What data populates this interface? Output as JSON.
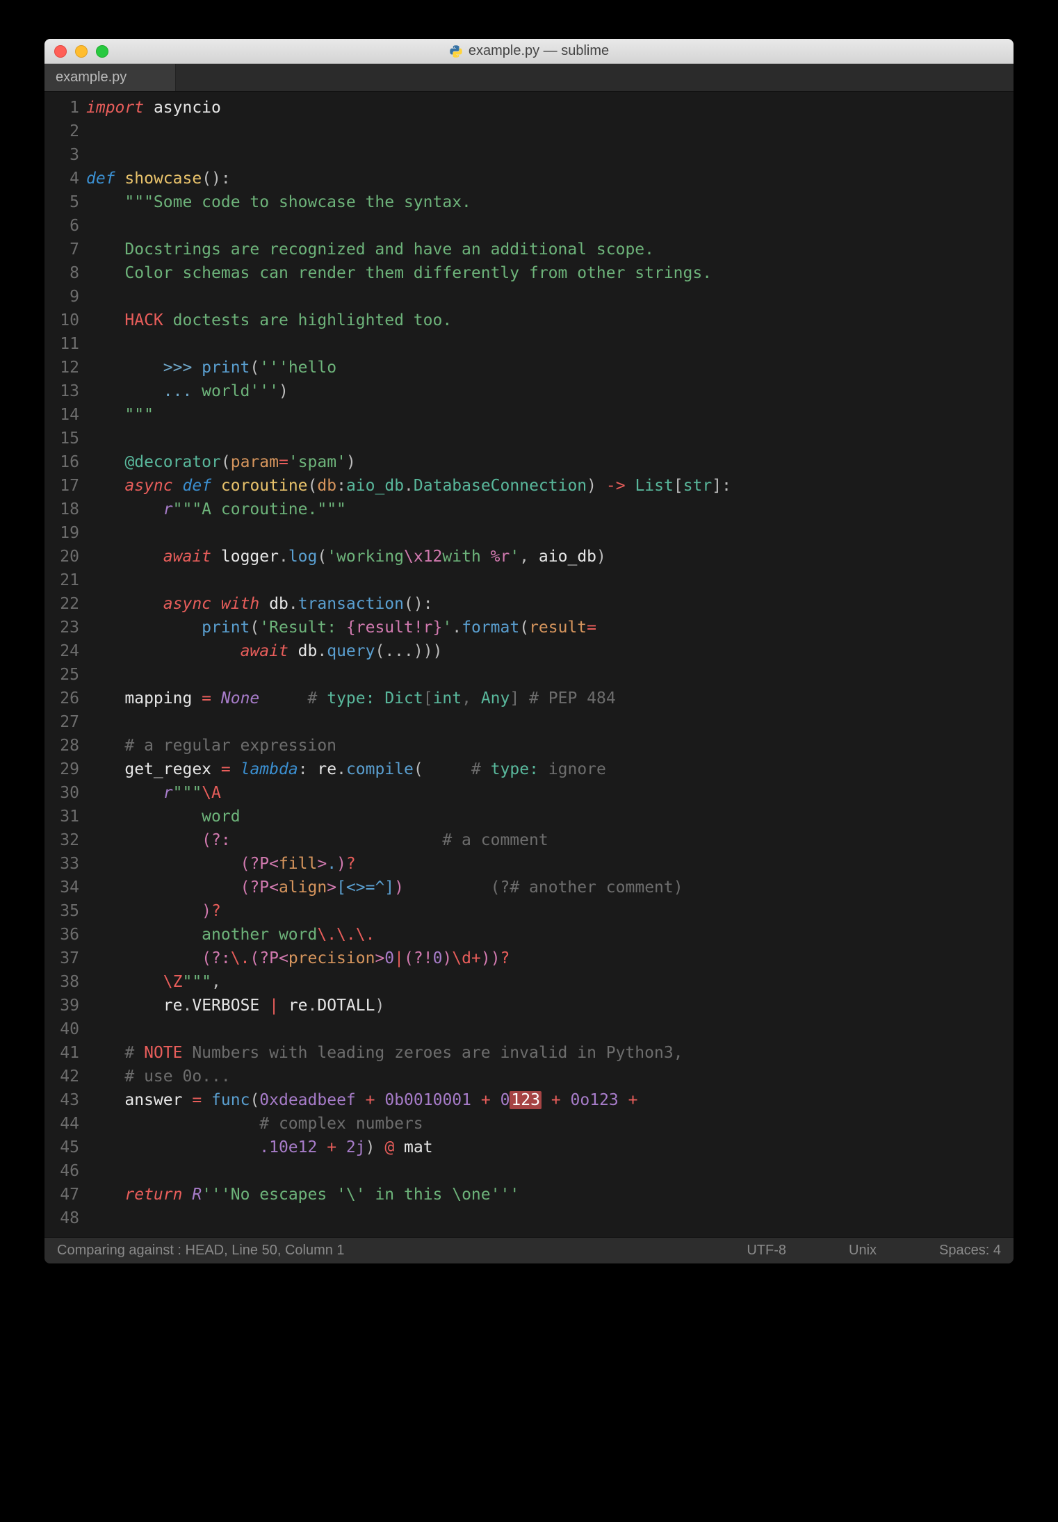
{
  "window": {
    "title": "example.py — sublime",
    "tab": "example.py"
  },
  "statusbar": {
    "left": "Comparing against : HEAD, Line 50, Column 1",
    "encoding": "UTF-8",
    "line_ending": "Unix",
    "indent": "Spaces: 4"
  },
  "gutter": {
    "start": 1,
    "end": 48
  },
  "code_lines": [
    [
      [
        "kw-red",
        "import"
      ],
      [
        "white",
        " asyncio"
      ]
    ],
    [],
    [],
    [
      [
        "kw-blue",
        "def"
      ],
      [
        "white",
        " "
      ],
      [
        "def-yellow",
        "showcase"
      ],
      [
        "paren",
        "():"
      ]
    ],
    [
      [
        "white",
        "    "
      ],
      [
        "str-green",
        "\"\"\"Some code to showcase the syntax."
      ]
    ],
    [],
    [
      [
        "white",
        "    "
      ],
      [
        "str-green",
        "Docstrings are recognized and have an additional scope."
      ]
    ],
    [
      [
        "white",
        "    "
      ],
      [
        "str-green",
        "Color schemas can render them differently from other strings."
      ]
    ],
    [],
    [
      [
        "white",
        "    "
      ],
      [
        "tag-red",
        "HACK"
      ],
      [
        "str-green",
        " doctests are highlighted too."
      ]
    ],
    [],
    [
      [
        "white",
        "        "
      ],
      [
        "doctest",
        ">>> "
      ],
      [
        "call-blue",
        "print"
      ],
      [
        "paren",
        "("
      ],
      [
        "str-green",
        "'''hello"
      ]
    ],
    [
      [
        "white",
        "        "
      ],
      [
        "doctest",
        "... "
      ],
      [
        "str-green",
        "world'''"
      ],
      [
        "paren",
        ")"
      ]
    ],
    [
      [
        "white",
        "    "
      ],
      [
        "str-green",
        "\"\"\""
      ]
    ],
    [],
    [
      [
        "white",
        "    "
      ],
      [
        "deco",
        "@decorator"
      ],
      [
        "paren",
        "("
      ],
      [
        "param-orange",
        "param"
      ],
      [
        "op-red",
        "="
      ],
      [
        "str-green",
        "'spam'"
      ],
      [
        "paren",
        ")"
      ]
    ],
    [
      [
        "white",
        "    "
      ],
      [
        "kw-red",
        "async"
      ],
      [
        "white",
        " "
      ],
      [
        "kw-blue",
        "def"
      ],
      [
        "white",
        " "
      ],
      [
        "def-yellow",
        "coroutine"
      ],
      [
        "paren",
        "("
      ],
      [
        "param-orange",
        "db"
      ],
      [
        "punct",
        ":"
      ],
      [
        "type-cyan",
        "aio_db"
      ],
      [
        "punct",
        "."
      ],
      [
        "type-cyan",
        "DatabaseConnection"
      ],
      [
        "paren",
        ")"
      ],
      [
        "white",
        " "
      ],
      [
        "arrow",
        "->"
      ],
      [
        "white",
        " "
      ],
      [
        "type-cyan",
        "List"
      ],
      [
        "punct",
        "["
      ],
      [
        "type-cyan",
        "str"
      ],
      [
        "punct",
        "]"
      ],
      [
        "punct",
        ":"
      ]
    ],
    [
      [
        "white",
        "        "
      ],
      [
        "r-prefix",
        "r"
      ],
      [
        "str-green",
        "\"\"\"A coroutine.\"\"\""
      ]
    ],
    [],
    [
      [
        "white",
        "        "
      ],
      [
        "kw-red",
        "await"
      ],
      [
        "white",
        " logger"
      ],
      [
        "punct",
        "."
      ],
      [
        "call-blue",
        "log"
      ],
      [
        "paren",
        "("
      ],
      [
        "str-green",
        "'working"
      ],
      [
        "esc-pink",
        "\\x12"
      ],
      [
        "str-green",
        "with "
      ],
      [
        "esc-pink",
        "%r"
      ],
      [
        "str-green",
        "'"
      ],
      [
        "punct",
        ","
      ],
      [
        "white",
        " aio_db"
      ],
      [
        "paren",
        ")"
      ]
    ],
    [],
    [
      [
        "white",
        "        "
      ],
      [
        "kw-red",
        "async"
      ],
      [
        "white",
        " "
      ],
      [
        "kw-red",
        "with"
      ],
      [
        "white",
        " db"
      ],
      [
        "punct",
        "."
      ],
      [
        "call-blue",
        "transaction"
      ],
      [
        "paren",
        "():"
      ]
    ],
    [
      [
        "white",
        "            "
      ],
      [
        "call-blue",
        "print"
      ],
      [
        "paren",
        "("
      ],
      [
        "str-green",
        "'Result: "
      ],
      [
        "esc-pink",
        "{result!r}"
      ],
      [
        "str-green",
        "'"
      ],
      [
        "punct",
        "."
      ],
      [
        "call-blue",
        "format"
      ],
      [
        "paren",
        "("
      ],
      [
        "param-orange",
        "result"
      ],
      [
        "op-red",
        "="
      ]
    ],
    [
      [
        "white",
        "                "
      ],
      [
        "kw-red",
        "await"
      ],
      [
        "white",
        " db"
      ],
      [
        "punct",
        "."
      ],
      [
        "call-blue",
        "query"
      ],
      [
        "paren",
        "("
      ],
      [
        "punct",
        "..."
      ],
      [
        "paren",
        ")))"
      ]
    ],
    [],
    [
      [
        "white",
        "    mapping "
      ],
      [
        "op-red",
        "="
      ],
      [
        "white",
        " "
      ],
      [
        "const-purple",
        "None"
      ],
      [
        "white",
        "     "
      ],
      [
        "comment",
        "# "
      ],
      [
        "type-cyan",
        "type: Dict"
      ],
      [
        "comment",
        "["
      ],
      [
        "type-cyan",
        "int"
      ],
      [
        "comment",
        ", "
      ],
      [
        "type-cyan",
        "Any"
      ],
      [
        "comment",
        "] "
      ],
      [
        "comment",
        "# PEP 484"
      ]
    ],
    [],
    [
      [
        "white",
        "    "
      ],
      [
        "comment",
        "# a regular expression"
      ]
    ],
    [
      [
        "white",
        "    get_regex "
      ],
      [
        "op-red",
        "="
      ],
      [
        "white",
        " "
      ],
      [
        "kw-blue",
        "lambda"
      ],
      [
        "punct",
        ":"
      ],
      [
        "white",
        " re"
      ],
      [
        "punct",
        "."
      ],
      [
        "call-blue",
        "compile"
      ],
      [
        "paren",
        "("
      ],
      [
        "white",
        "     "
      ],
      [
        "comment",
        "# "
      ],
      [
        "type-cyan",
        "type: "
      ],
      [
        "comment",
        "ignore"
      ]
    ],
    [
      [
        "white",
        "        "
      ],
      [
        "r-prefix",
        "r"
      ],
      [
        "str-green",
        "\"\"\""
      ],
      [
        "regex-kw",
        "\\A"
      ]
    ],
    [
      [
        "white",
        "            "
      ],
      [
        "str-green",
        "word"
      ]
    ],
    [
      [
        "white",
        "            "
      ],
      [
        "regex-grp",
        "(?:"
      ],
      [
        "white",
        "                      "
      ],
      [
        "comment",
        "# a comment"
      ]
    ],
    [
      [
        "white",
        "                "
      ],
      [
        "regex-grp",
        "(?P<"
      ],
      [
        "param-orange",
        "fill"
      ],
      [
        "regex-grp",
        ">"
      ],
      [
        "regex-cls",
        "."
      ],
      [
        "regex-grp",
        ")"
      ],
      [
        "regex-q",
        "?"
      ]
    ],
    [
      [
        "white",
        "                "
      ],
      [
        "regex-grp",
        "(?P<"
      ],
      [
        "param-orange",
        "align"
      ],
      [
        "regex-grp",
        ">"
      ],
      [
        "regex-cls",
        "[<>=^]"
      ],
      [
        "regex-grp",
        ")"
      ],
      [
        "white",
        "         "
      ],
      [
        "comment",
        "(?# another comment)"
      ]
    ],
    [
      [
        "white",
        "            "
      ],
      [
        "regex-grp",
        ")"
      ],
      [
        "regex-q",
        "?"
      ]
    ],
    [
      [
        "white",
        "            "
      ],
      [
        "str-green",
        "another word"
      ],
      [
        "regex-kw",
        "\\."
      ],
      [
        "regex-kw",
        "\\."
      ],
      [
        "regex-kw",
        "\\."
      ]
    ],
    [
      [
        "white",
        "            "
      ],
      [
        "regex-grp",
        "(?:"
      ],
      [
        "regex-kw",
        "\\."
      ],
      [
        "regex-grp",
        "(?P<"
      ],
      [
        "param-orange",
        "precision"
      ],
      [
        "regex-grp",
        ">"
      ],
      [
        "num-purple",
        "0"
      ],
      [
        "op-red",
        "|"
      ],
      [
        "regex-grp",
        "(?!"
      ],
      [
        "num-purple",
        "0"
      ],
      [
        "regex-grp",
        ")"
      ],
      [
        "regex-kw",
        "\\d"
      ],
      [
        "regex-q",
        "+"
      ],
      [
        "regex-grp",
        "))"
      ],
      [
        "regex-q",
        "?"
      ]
    ],
    [
      [
        "white",
        "        "
      ],
      [
        "regex-kw",
        "\\Z"
      ],
      [
        "str-green",
        "\"\"\""
      ],
      [
        "punct",
        ","
      ]
    ],
    [
      [
        "white",
        "        re"
      ],
      [
        "punct",
        "."
      ],
      [
        "white",
        "VERBOSE "
      ],
      [
        "op-red",
        "|"
      ],
      [
        "white",
        " re"
      ],
      [
        "punct",
        "."
      ],
      [
        "white",
        "DOTALL"
      ],
      [
        "paren",
        ")"
      ]
    ],
    [],
    [
      [
        "white",
        "    "
      ],
      [
        "comment",
        "# "
      ],
      [
        "tag-red",
        "NOTE"
      ],
      [
        "comment",
        " Numbers with leading zeroes are invalid in Python3,"
      ]
    ],
    [
      [
        "white",
        "    "
      ],
      [
        "comment",
        "# use 0o..."
      ]
    ],
    [
      [
        "white",
        "    answer "
      ],
      [
        "op-red",
        "="
      ],
      [
        "white",
        " "
      ],
      [
        "call-blue",
        "func"
      ],
      [
        "paren",
        "("
      ],
      [
        "num-purple",
        "0xdeadbeef"
      ],
      [
        "white",
        " "
      ],
      [
        "op-red",
        "+"
      ],
      [
        "white",
        " "
      ],
      [
        "num-purple",
        "0b0010001"
      ],
      [
        "white",
        " "
      ],
      [
        "op-red",
        "+"
      ],
      [
        "white",
        " "
      ],
      [
        "num-purple",
        "0"
      ],
      [
        "invalid",
        "123"
      ],
      [
        "white",
        " "
      ],
      [
        "op-red",
        "+"
      ],
      [
        "white",
        " "
      ],
      [
        "num-purple",
        "0o123"
      ],
      [
        "white",
        " "
      ],
      [
        "op-red",
        "+"
      ]
    ],
    [
      [
        "white",
        "                  "
      ],
      [
        "comment",
        "# complex numbers"
      ]
    ],
    [
      [
        "white",
        "                  "
      ],
      [
        "num-purple",
        ".10e12"
      ],
      [
        "white",
        " "
      ],
      [
        "op-red",
        "+"
      ],
      [
        "white",
        " "
      ],
      [
        "num-purple",
        "2j"
      ],
      [
        "paren",
        ")"
      ],
      [
        "white",
        " "
      ],
      [
        "op-red",
        "@"
      ],
      [
        "white",
        " mat"
      ]
    ],
    [],
    [
      [
        "white",
        "    "
      ],
      [
        "kw-red",
        "return"
      ],
      [
        "white",
        " "
      ],
      [
        "r-prefix",
        "R"
      ],
      [
        "str-green",
        "'''No escapes '\\' in this \\one'''"
      ]
    ],
    []
  ]
}
